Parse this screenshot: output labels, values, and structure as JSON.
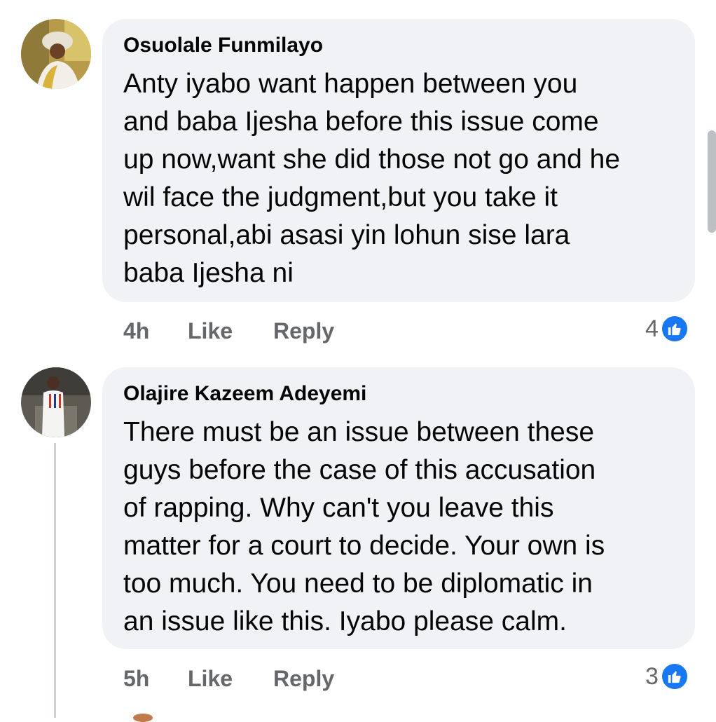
{
  "comments": [
    {
      "author": "Osuolale Funmilayo",
      "text": "Anty iyabo want happen between you\nand baba Ijesha before this issue come\nup now,want she did those not go and he\nwil face the judgment,but you take it\npersonal,abi asasi yin lohun sise lara\nbaba Ijesha ni",
      "time": "4h",
      "like_label": "Like",
      "reply_label": "Reply",
      "reaction_count": "4",
      "reaction_icon": "like-icon",
      "accent": "#1877f2"
    },
    {
      "author": "Olajire Kazeem Adeyemi",
      "text": "There must be an issue between these\nguys before the case of this accusation\nof rapping. Why can't you leave this\nmatter for a court to decide. Your own is\ntoo much. You need to be diplomatic in\nan issue like this. Iyabo please calm.",
      "time": "5h",
      "like_label": "Like",
      "reply_label": "Reply",
      "reaction_count": "3",
      "reaction_icon": "like-icon",
      "accent": "#1877f2"
    }
  ],
  "colors": {
    "bubble": "#f0f2f5",
    "secondary_text": "#65676b",
    "primary_text": "#050505"
  }
}
